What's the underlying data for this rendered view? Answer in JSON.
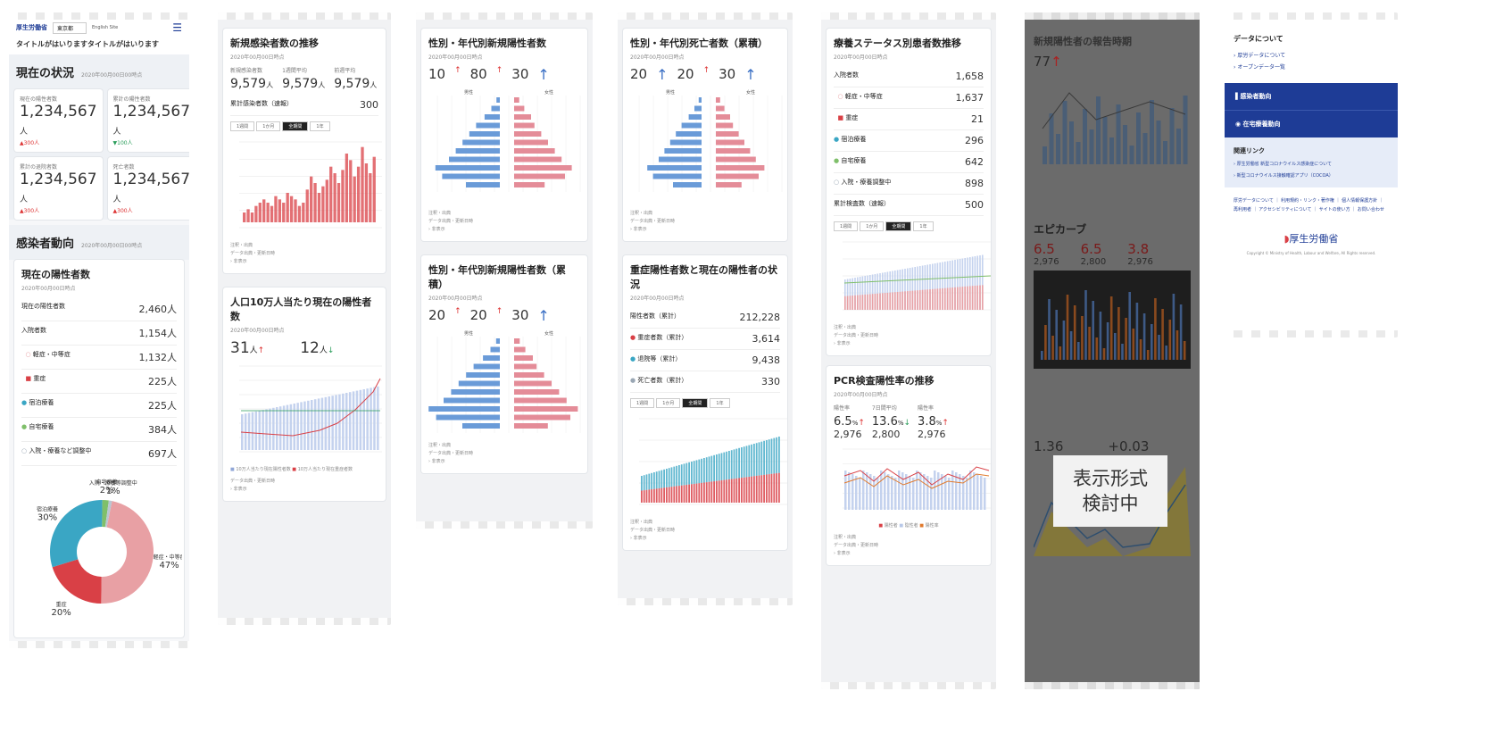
{
  "strip1": {
    "brand": "厚生労働省",
    "select_value": "東京都",
    "english_link": "English Site",
    "tagline": "タイトルがはいりますタイトルがはいります",
    "status_title": "現在の状況",
    "status_date": "2020年00月00日00時点",
    "stat_tiles": [
      {
        "label": "現在の陽性者数",
        "value": "1,234,567",
        "unit": "人",
        "delta": "▲300人"
      },
      {
        "label": "累計の陽性者数",
        "value": "1,234,567",
        "unit": "人",
        "delta": "▼100人"
      },
      {
        "label": "累計の退院者数",
        "value": "1,234,567",
        "unit": "人",
        "delta": "▲300人"
      },
      {
        "label": "死亡者数",
        "value": "1,234,567",
        "unit": "人",
        "delta": "▲300人"
      }
    ],
    "trend_title": "感染者動向",
    "trend_date": "2020年00月00日00時点",
    "positive_card_title": "現在の陽性者数",
    "positive_card_date": "2020年00月00日時点",
    "positive_rows": [
      {
        "label": "現在の陽性者数",
        "value": "2,460",
        "unit": "人"
      },
      {
        "label": "入院者数",
        "value": "1,154",
        "unit": "人"
      },
      {
        "label": "軽症・中等症",
        "value": "1,132",
        "unit": "人"
      },
      {
        "label": "重症",
        "value": "225",
        "unit": "人"
      },
      {
        "label": "宿泊療養",
        "value": "225",
        "unit": "人"
      },
      {
        "label": "自宅療養",
        "value": "384",
        "unit": "人"
      },
      {
        "label": "入院・療養など調整中",
        "value": "697",
        "unit": "人"
      }
    ],
    "donut": [
      {
        "label": "軽症・中等症",
        "value": "47",
        "unit": "%"
      },
      {
        "label": "重症",
        "value": "20",
        "unit": "%"
      },
      {
        "label": "宿泊療養",
        "value": "30",
        "unit": "%"
      },
      {
        "label": "自宅療養",
        "value": "2",
        "unit": "%"
      },
      {
        "label": "入院・療養等調整中",
        "value": "1",
        "unit": "%"
      }
    ],
    "donut_colors": [
      "#e8a0a4",
      "#d94046",
      "#3aa6c4",
      "#7fbf6a",
      "#b9c6d2"
    ]
  },
  "strip2": {
    "new_cases_title": "新規感染者数の推移",
    "new_cases_date": "2020年00月00日時点",
    "new_cases_stats": [
      {
        "label": "新規感染者数",
        "value": "9,579",
        "unit": "人"
      },
      {
        "label": "1週間平均",
        "value": "9,579",
        "unit": "人"
      },
      {
        "label": "前週平均",
        "value": "9,579",
        "unit": "人"
      }
    ],
    "cumulative_label": "累計感染者数（速報）",
    "cumulative_value": "300",
    "tabs": [
      "1週間",
      "1か月",
      "全期間",
      "1年"
    ],
    "per100k_title": "人口10万人当たり現在の陽性者数",
    "per100k_date": "2020年00月00日時点",
    "per100k_current": "31",
    "per100k_prev": "12",
    "per100k_unit": "人",
    "legend": [
      "10万人当たり現在陽性者数",
      "10万人当たり現在重症者数"
    ]
  },
  "strip3": {
    "age_title": "性別・年代別新規陽性者数",
    "age_date": "2020年00月00日時点",
    "age_stats": [
      "10",
      "80",
      "30"
    ],
    "age_title2": "性別・年代別新規陽性者数（累積）",
    "age_stats2": [
      "20",
      "20",
      "30"
    ],
    "male": "男性",
    "female": "女性"
  },
  "strip4": {
    "death_title": "性別・年代別死亡者数（累積）",
    "death_date": "2020年00月00日時点",
    "death_stats": [
      "20",
      "20",
      "30"
    ],
    "severe_title": "重症陽性者数と現在の陽性者の状況",
    "severe_date": "2020年00月00日時点",
    "severe_rows": [
      {
        "label": "陽性者数（累計）",
        "value": "212,228"
      },
      {
        "label": "重症者数（累計）",
        "value": "3,614"
      },
      {
        "label": "退院等（累計）",
        "value": "9,438"
      },
      {
        "label": "死亡者数（累計）",
        "value": "330"
      }
    ]
  },
  "strip5": {
    "status_title": "療養ステータス別患者数推移",
    "status_date": "2020年00月00日時点",
    "status_rows": [
      {
        "label": "入院者数",
        "value": "1,658"
      },
      {
        "label": "軽症・中等症",
        "value": "1,637"
      },
      {
        "label": "重症",
        "value": "21"
      },
      {
        "label": "宿泊療養",
        "value": "296"
      },
      {
        "label": "自宅療養",
        "value": "642"
      },
      {
        "label": "入院・療養調整中",
        "value": "898"
      }
    ],
    "status_total_label": "累計検査数（速報）",
    "status_total": "500",
    "pcr_title": "PCR検査陽性率の推移",
    "pcr_date": "2020年00月00日時点",
    "pcr_stats": [
      {
        "label": "陽性率",
        "value": "6.5",
        "unit": "%",
        "sub": "2,976"
      },
      {
        "label": "7日間平均",
        "value": "13.6",
        "unit": "%",
        "sub": "2,800"
      },
      {
        "label": "陽性率",
        "value": "3.8",
        "unit": "%",
        "sub": "2,976"
      }
    ],
    "pcr_legend": [
      "陽性者",
      "陰性者",
      "陽性率"
    ]
  },
  "strip6": {
    "title": "新規陽性者の報告時期",
    "value": "77",
    "epi_title": "エピカーブ",
    "epi_stats": [
      "6.5",
      "6.5",
      "3.8"
    ],
    "epi_subs": [
      "2,976",
      "2,800",
      "2,976"
    ],
    "overlay": "表示形式\n検討中",
    "rt_current": "1.36",
    "rt_change": "+0.03"
  },
  "strip7": {
    "about_title": "データについて",
    "about_links": [
      "厚労データについて",
      "オープンデータ一覧"
    ],
    "nav_items": [
      "感染者動向",
      "在宅療養動向"
    ],
    "related_title": "関連リンク",
    "related_links": [
      "厚生労働省 新型コロナウイルス感染症について",
      "新型コロナウイルス接触確認アプリ（COCOA）"
    ],
    "footer_links": "厚労データについて ｜ 利用規約・リンク・著作権 ｜ 個人情報保護方針 ｜ 再利用者 ｜ アクセシビリティについて ｜ サイトの使い方 ｜ お問い合わせ",
    "logo_text": "厚生労働省",
    "copyright": "Copyright © Ministry of Health, Labour and Welfare, All Rights reserved."
  }
}
